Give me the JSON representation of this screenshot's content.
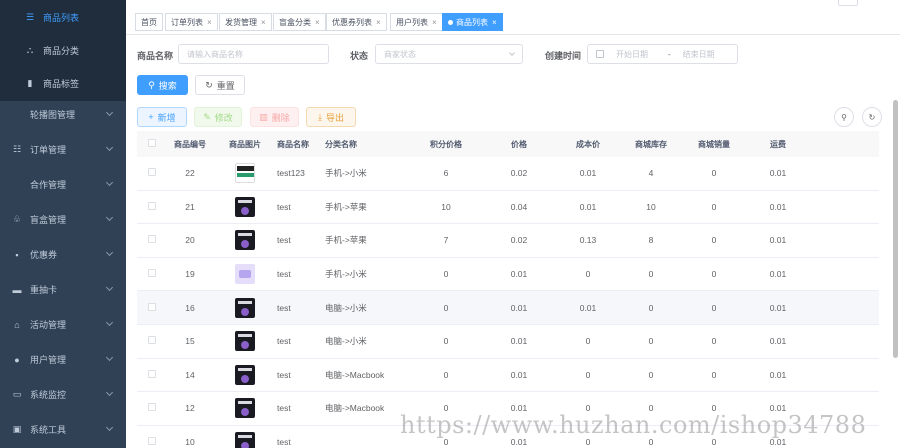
{
  "sidebar": {
    "items": [
      {
        "label": "商品列表",
        "icon": "list-icon",
        "glyph": "☰",
        "sub": true,
        "active": true,
        "chevron": false
      },
      {
        "label": "商品分类",
        "icon": "category-tree-icon",
        "glyph": "⛬",
        "sub": true,
        "active": false,
        "chevron": false
      },
      {
        "label": "商品标签",
        "icon": "tag-icon",
        "glyph": "▮",
        "sub": true,
        "active": false,
        "chevron": false
      },
      {
        "label": "轮播图管理",
        "icon": "carousel-icon",
        "glyph": "",
        "sub": false,
        "active": false,
        "chevron": true
      },
      {
        "label": "订单管理",
        "icon": "order-icon",
        "glyph": "☷",
        "sub": false,
        "active": false,
        "chevron": true
      },
      {
        "label": "合作管理",
        "icon": "",
        "glyph": "",
        "sub": false,
        "active": false,
        "chevron": true
      },
      {
        "label": "盲盒管理",
        "icon": "blind-box-icon",
        "glyph": "♧",
        "sub": false,
        "active": false,
        "chevron": true
      },
      {
        "label": "优惠券",
        "icon": "coupon-icon",
        "glyph": "▪",
        "sub": false,
        "active": false,
        "chevron": true
      },
      {
        "label": "重抽卡",
        "icon": "card-icon",
        "glyph": "▬",
        "sub": false,
        "active": false,
        "chevron": true
      },
      {
        "label": "活动管理",
        "icon": "activity-icon",
        "glyph": "⌂",
        "sub": false,
        "active": false,
        "chevron": true
      },
      {
        "label": "用户管理",
        "icon": "user-icon",
        "glyph": "●",
        "sub": false,
        "active": false,
        "chevron": true
      },
      {
        "label": "系统监控",
        "icon": "monitor-icon",
        "glyph": "▭",
        "sub": false,
        "active": false,
        "chevron": true
      },
      {
        "label": "系统工具",
        "icon": "tool-icon",
        "glyph": "▣",
        "sub": false,
        "active": false,
        "chevron": true
      }
    ]
  },
  "tabs": [
    {
      "label": "首页",
      "closable": false,
      "active": false
    },
    {
      "label": "订单列表",
      "closable": true,
      "active": false
    },
    {
      "label": "发货管理",
      "closable": true,
      "active": false
    },
    {
      "label": "盲盒分类",
      "closable": true,
      "active": false
    },
    {
      "label": "优惠券列表",
      "closable": true,
      "active": false
    },
    {
      "label": "用户列表",
      "closable": true,
      "active": false
    },
    {
      "label": "商品列表",
      "closable": true,
      "active": true
    }
  ],
  "close_glyph": "×",
  "search": {
    "name_label": "商品名称",
    "name_placeholder": "请输入商品名称",
    "status_label": "状态",
    "status_placeholder": "商家状态",
    "created_label": "创建时间",
    "start_placeholder": "开始日期",
    "separator": "-",
    "end_placeholder": "结束日期",
    "search_button": "搜索",
    "reset_button": "重置"
  },
  "toolbar": {
    "add": "新增",
    "edit": "修改",
    "delete": "删除",
    "export": "导出"
  },
  "table": {
    "headers": [
      "商品编号",
      "商品图片",
      "商品名称",
      "分类名称",
      "积分价格",
      "价格",
      "成本价",
      "商城库存",
      "商城销量",
      "运费"
    ],
    "rows": [
      {
        "id": "22",
        "img": "white",
        "name": "test123",
        "category": "手机->小米",
        "points": "6",
        "price": "0.02",
        "cost": "0.01",
        "stock": "4",
        "sales": "0",
        "freight": "0.01"
      },
      {
        "id": "21",
        "img": "dark",
        "name": "test",
        "category": "手机->苹果",
        "points": "10",
        "price": "0.04",
        "cost": "0.01",
        "stock": "10",
        "sales": "0",
        "freight": "0.01"
      },
      {
        "id": "20",
        "img": "dark",
        "name": "test",
        "category": "手机->苹果",
        "points": "7",
        "price": "0.02",
        "cost": "0.13",
        "stock": "8",
        "sales": "0",
        "freight": "0.01"
      },
      {
        "id": "19",
        "img": "lilac",
        "name": "test",
        "category": "手机->小米",
        "points": "0",
        "price": "0.01",
        "cost": "0",
        "stock": "0",
        "sales": "0",
        "freight": "0.01"
      },
      {
        "id": "16",
        "img": "dark",
        "name": "test",
        "category": "电脑->小米",
        "points": "0",
        "price": "0.01",
        "cost": "0.01",
        "stock": "0",
        "sales": "0",
        "freight": "0.01"
      },
      {
        "id": "15",
        "img": "dark",
        "name": "test",
        "category": "电脑->小米",
        "points": "0",
        "price": "0.01",
        "cost": "0",
        "stock": "0",
        "sales": "0",
        "freight": "0.01"
      },
      {
        "id": "14",
        "img": "dark",
        "name": "test",
        "category": "电脑->Macbook",
        "points": "0",
        "price": "0.01",
        "cost": "0",
        "stock": "0",
        "sales": "0",
        "freight": "0.01"
      },
      {
        "id": "12",
        "img": "dark",
        "name": "test",
        "category": "电脑->Macbook",
        "points": "0",
        "price": "0.01",
        "cost": "0",
        "stock": "0",
        "sales": "0",
        "freight": "0.01"
      },
      {
        "id": "10",
        "img": "dark",
        "name": "test",
        "category": "",
        "points": "0",
        "price": "0.01",
        "cost": "0",
        "stock": "0",
        "sales": "0",
        "freight": "0.01"
      }
    ]
  },
  "watermark": "https://www.huzhan.com/ishop34788",
  "colors": {
    "sidebar": "#304156",
    "primary": "#409eff",
    "warning": "#e6a23c"
  }
}
